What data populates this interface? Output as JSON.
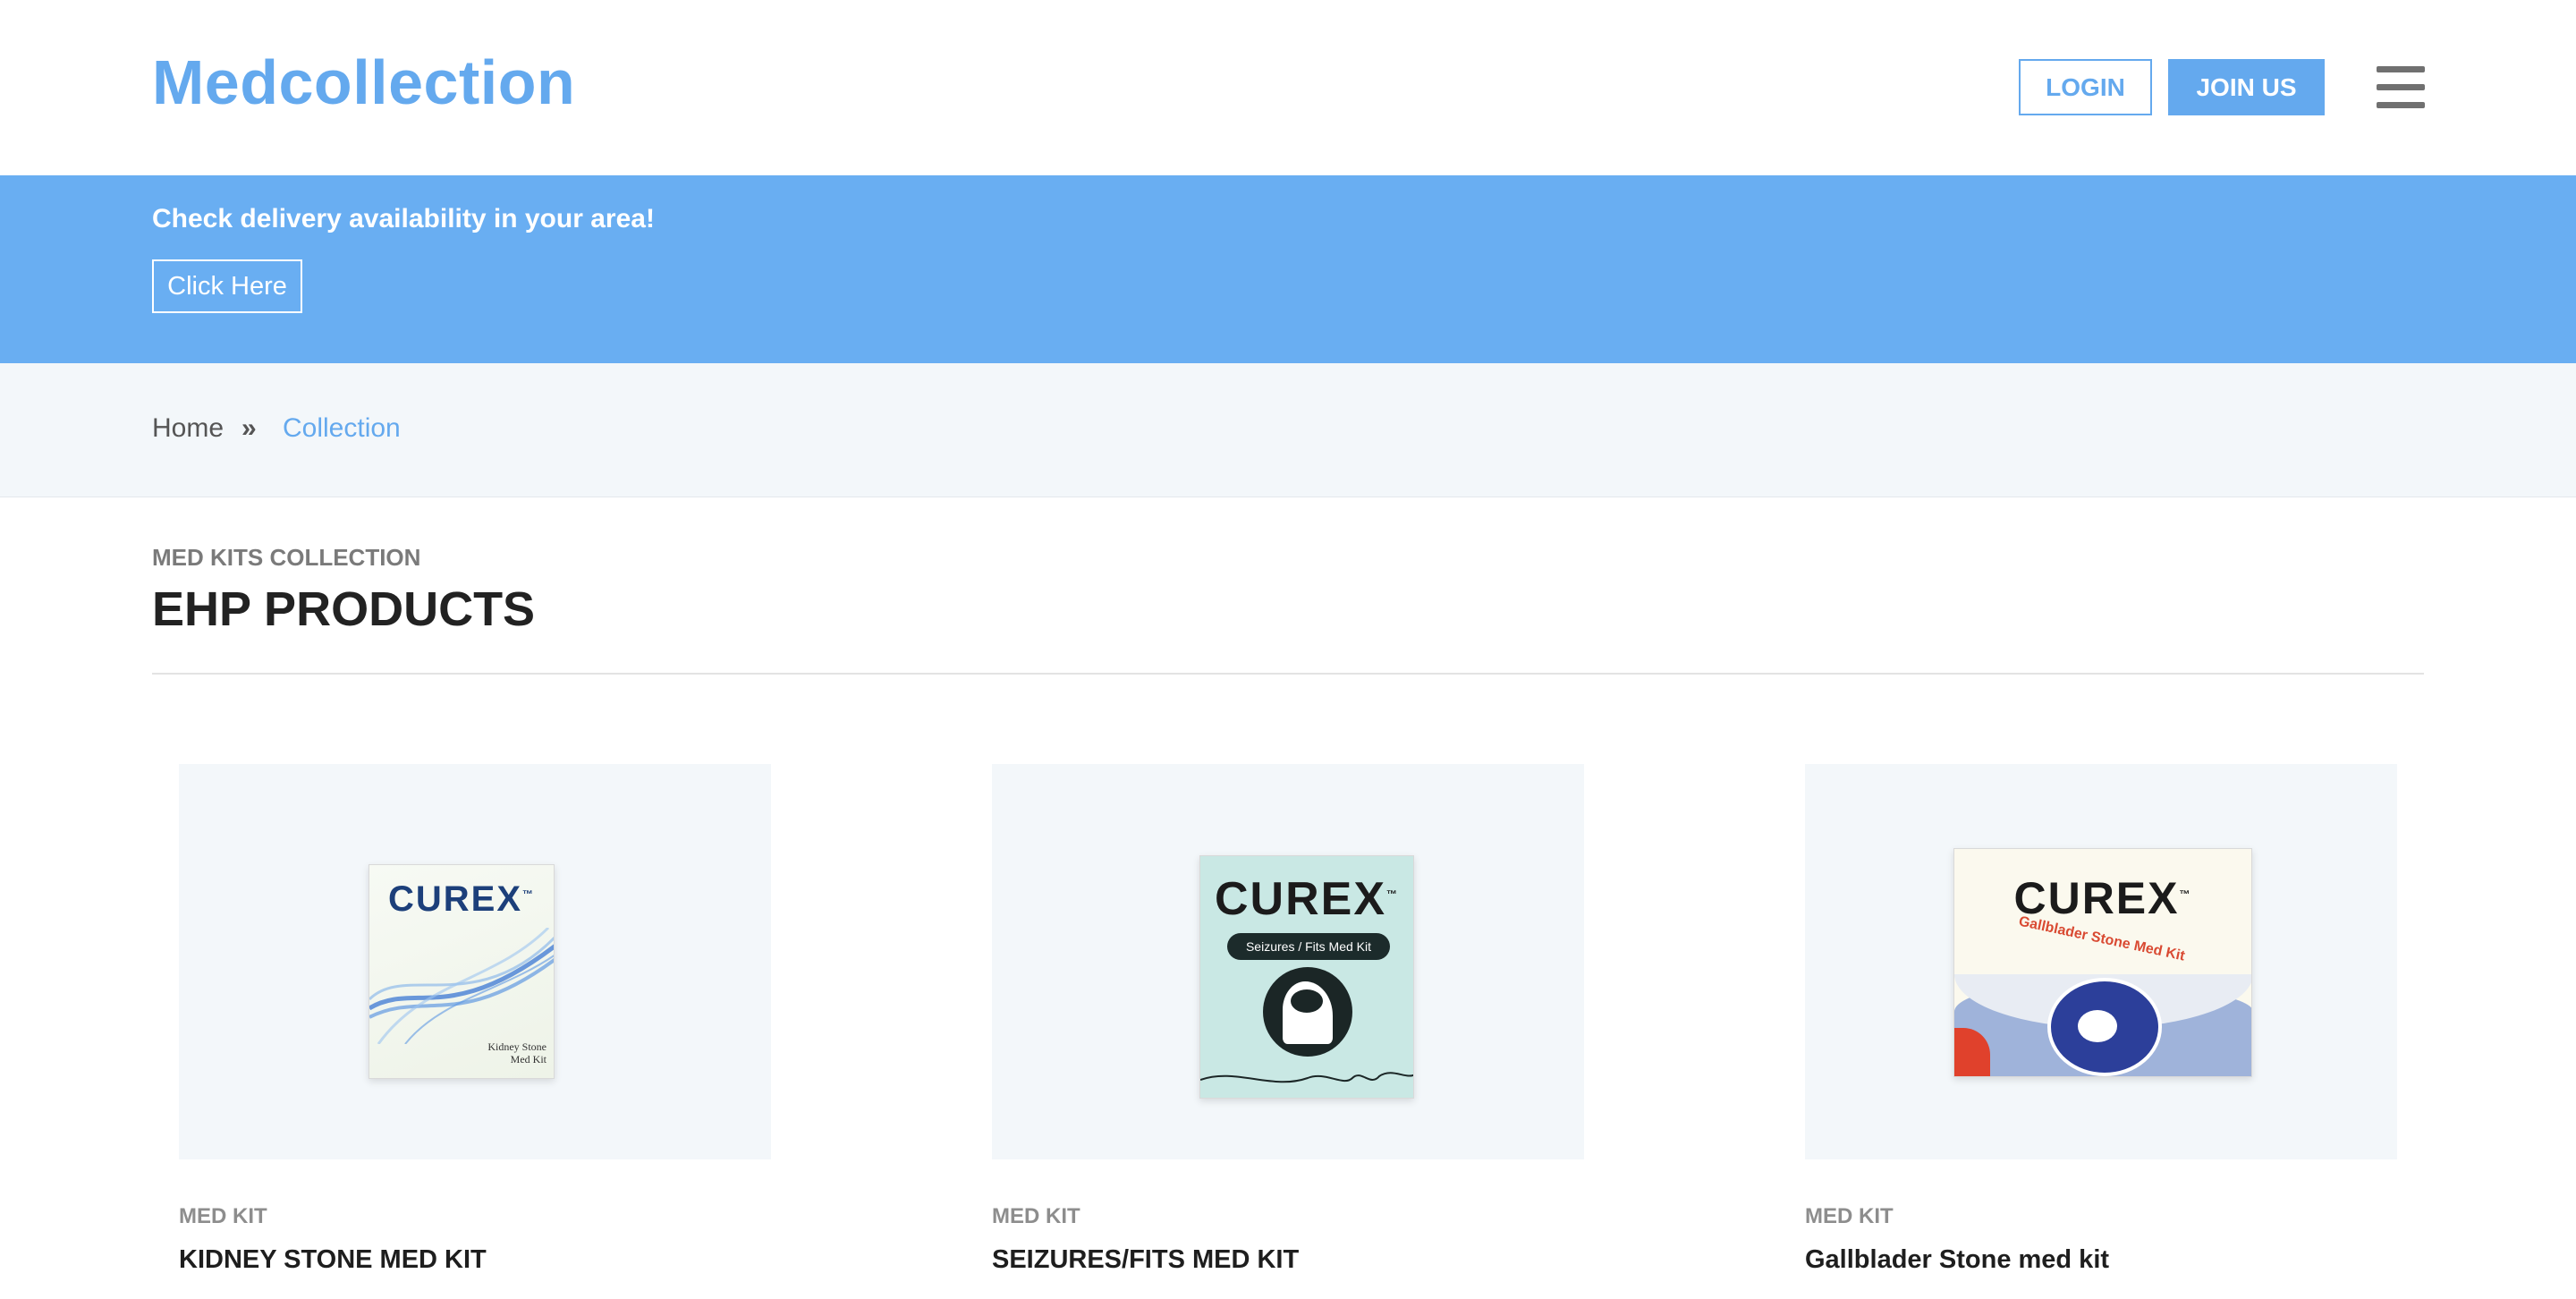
{
  "header": {
    "brand": "Medcollection",
    "login_label": "LOGIN",
    "join_label": "JOIN US"
  },
  "banner": {
    "text": "Check delivery availability in your area!",
    "button_label": "Click Here"
  },
  "breadcrumb": {
    "home": "Home",
    "separator": "»",
    "current": "Collection"
  },
  "section": {
    "kicker": "MED KITS COLLECTION",
    "title": "EHP PRODUCTS"
  },
  "products": [
    {
      "category": "MED KIT",
      "name": "KIDNEY STONE MED KIT",
      "package_brand": "CUREX",
      "package_label_line1": "Kidney Stone",
      "package_label_line2": "Med Kit"
    },
    {
      "category": "MED KIT",
      "name": "SEIZURES/FITS MED KIT",
      "package_brand": "CUREX",
      "package_label": "Seizures / Fits Med Kit"
    },
    {
      "category": "MED KIT",
      "name": "Gallblader Stone med kit",
      "package_brand": "CUREX",
      "package_label": "Gallblader Stone Med Kit"
    }
  ],
  "colors": {
    "accent": "#64a9ee",
    "banner": "#69aef2",
    "crumb_bg": "#f3f7fa",
    "card_bg": "#f3f7fa"
  },
  "icons": {
    "menu": "hamburger-menu-icon",
    "breadcrumb_separator": "double-chevron-right-icon"
  }
}
